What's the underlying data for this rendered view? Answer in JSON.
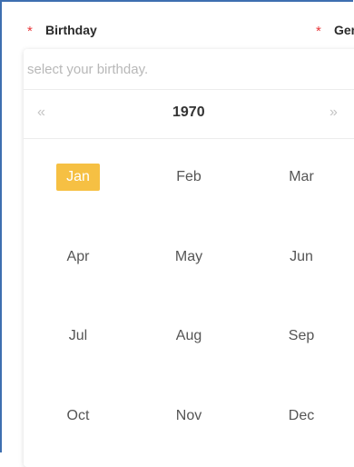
{
  "form": {
    "birthday_label": "Birthday",
    "gender_label": "Gen",
    "required_mark": "*"
  },
  "picker": {
    "placeholder": "select your birthday.",
    "year": "1970",
    "prev_year": "«",
    "next_year": "»",
    "months": [
      "Jan",
      "Feb",
      "Mar",
      "Apr",
      "May",
      "Jun",
      "Jul",
      "Aug",
      "Sep",
      "Oct",
      "Nov",
      "Dec"
    ],
    "selected_month": "Jan"
  },
  "colors": {
    "frame_border": "#3e6fb0",
    "required": "#e8383b",
    "selected_bg": "#f6c043"
  }
}
